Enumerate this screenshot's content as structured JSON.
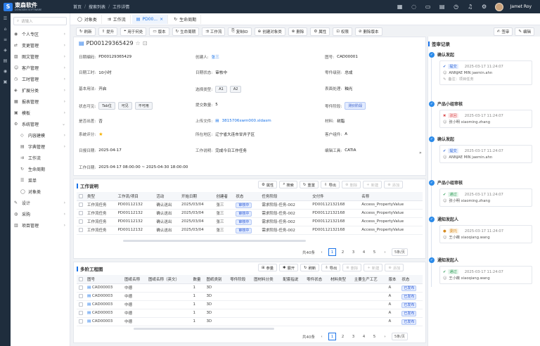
{
  "app": {
    "logo_text": "東森软件",
    "logo_sub": "DONGSEN SOFTWARE",
    "logo_mark": "S"
  },
  "breadcrumb": [
    "首页",
    "搜索列表",
    "工作详情"
  ],
  "user": {
    "name": "Jamet Roy"
  },
  "sidebar": {
    "search_placeholder": "请输入",
    "items": [
      {
        "label": "个人专区",
        "icon": "user-icon",
        "expandable": true
      },
      {
        "label": "变更管理",
        "icon": "swap-icon",
        "expandable": true
      },
      {
        "label": "图文管理",
        "icon": "image-icon",
        "expandable": true
      },
      {
        "label": "客户管理",
        "icon": "client-icon",
        "expandable": true
      },
      {
        "label": "工时管理",
        "icon": "clock-icon",
        "expandable": true
      },
      {
        "label": "扩展分类",
        "icon": "category-icon",
        "expandable": true
      },
      {
        "label": "报表管理",
        "icon": "report-icon",
        "expandable": true
      },
      {
        "label": "模板",
        "icon": "template-icon",
        "expandable": true
      },
      {
        "label": "系统管理",
        "icon": "system-icon",
        "expandable": true,
        "expanded": true
      }
    ],
    "sub_items": [
      {
        "label": "内容建模",
        "icon": "model-icon",
        "expandable": true
      },
      {
        "label": "字典管理",
        "icon": "dict-icon",
        "expandable": true
      },
      {
        "label": "工作流",
        "icon": "flow-icon"
      },
      {
        "label": "生命周期",
        "icon": "cycle-icon"
      },
      {
        "label": "菜单",
        "icon": "menu-icon"
      },
      {
        "label": "对象类",
        "icon": "object-icon"
      }
    ],
    "bottom_items": [
      {
        "label": "设计",
        "icon": "design-icon",
        "expandable": true
      },
      {
        "label": "采购",
        "icon": "cart-icon",
        "expandable": true
      },
      {
        "label": "项目管理",
        "icon": "project-icon",
        "expandable": true
      }
    ]
  },
  "tabs": [
    {
      "label": "对象类",
      "icon": "object-icon"
    },
    {
      "label": "工作流",
      "icon": "flow-icon"
    },
    {
      "label": "PD00...",
      "icon": "doc-icon",
      "active": true,
      "closable": true
    },
    {
      "label": "生命周期",
      "icon": "cycle-icon"
    }
  ],
  "toolbar": {
    "buttons": [
      {
        "label": "刷新",
        "icon": "refresh-icon"
      },
      {
        "label": "提升",
        "icon": "up-icon"
      },
      {
        "label": "用于何处",
        "icon": "where-icon"
      },
      {
        "label": "版本",
        "icon": "version-icon"
      },
      {
        "label": "生命周期",
        "icon": "cycle-icon"
      },
      {
        "label": "工作流",
        "icon": "flow-icon"
      },
      {
        "label": "复制ID",
        "icon": "copy-icon"
      },
      {
        "label": "创建对象类",
        "icon": "plus-icon"
      },
      {
        "label": "删除",
        "icon": "delete-icon"
      },
      {
        "label": "属性",
        "icon": "gear-icon"
      },
      {
        "label": "权限",
        "icon": "lock-icon"
      },
      {
        "label": "删除版本",
        "icon": "delete-version-icon"
      }
    ],
    "right": [
      {
        "label": "签审",
        "icon": "sign-icon"
      },
      {
        "label": "编辑",
        "icon": "edit-icon"
      }
    ]
  },
  "doc": {
    "id": "PD00129365429",
    "fields": [
      {
        "label": "日期编码:",
        "value": "PD00129365429"
      },
      {
        "label": "创建人:",
        "value": "张三",
        "link": true
      },
      {
        "label": "图号:",
        "value": "CAD00001"
      },
      {
        "label": "日期工时:",
        "value": "10小时"
      },
      {
        "label": "日期状态:",
        "value": "审核中"
      },
      {
        "label": "零件级别:",
        "value": "总成"
      },
      {
        "label": "基本用法:",
        "value": "开启"
      },
      {
        "label": "选择类型:",
        "chips": [
          "A1",
          "A2"
        ]
      },
      {
        "label": "表面处理:",
        "value": "釉光"
      },
      {
        "label": "状态可见:",
        "chips": [
          "Tab位",
          "可见",
          "不可用"
        ]
      },
      {
        "label": "提交数量:",
        "value": "5"
      },
      {
        "label": "零件阶段:",
        "chips_blue": [
          "测价阶段"
        ]
      },
      {
        "label": "是否出差:",
        "value": "否"
      },
      {
        "label": "上传文件:",
        "value": "3815706swm000.sldasm",
        "link": true
      },
      {
        "label": "材料:",
        "value": "树脂"
      },
      {
        "label": "系统评分:",
        "value": "★"
      },
      {
        "label": "所在地区:",
        "value": "辽宁省大连市甘井子区"
      },
      {
        "label": "客户组件:",
        "value": "A"
      },
      {
        "label": "日报日期:",
        "value": "2025-04-17"
      },
      {
        "label": "工作说明:",
        "value": "完成今日工作任务"
      },
      {
        "label": "编辑工具:",
        "value": "CATIA"
      },
      {
        "label": "工作日期:",
        "value": "2025-04-17 08:00:00 ~ 2025-04-30 18:00:00"
      }
    ]
  },
  "work_table": {
    "title": "工作说明",
    "buttons": [
      "属性",
      "搜索",
      "重置",
      "导出",
      "删除",
      "新建",
      "添加"
    ],
    "headers": [
      "类型",
      "工作流/项目",
      "活动",
      "开始日期",
      "创建者",
      "状态",
      "任务阶段",
      "交付件",
      "名称"
    ],
    "rows": [
      [
        "工作流任务",
        "PD00112132",
        "确认送出",
        "2025/03/04",
        "张三",
        "审核中",
        "需求阶段-任务-002",
        "PD00112132168",
        "Access_PropertyValue"
      ],
      [
        "工作流任务",
        "PD00112132",
        "确认送出",
        "2025/03/04",
        "张三",
        "审核中",
        "需求阶段-任务-002",
        "PD00112132168",
        "Access_PropertyValue"
      ],
      [
        "工作流任务",
        "PD00112132",
        "确认送出",
        "2025/03/04",
        "张三",
        "审核中",
        "需求阶段-任务-002",
        "PD00112132168",
        "Access_PropertyValue"
      ],
      [
        "工作流任务",
        "PD00112132",
        "确认送出",
        "2025/03/04",
        "张三",
        "审核中",
        "需求阶段-任务-002",
        "PD00112132168",
        "Access_PropertyValue"
      ]
    ],
    "pager": {
      "total": "共40条",
      "pages": [
        "1",
        "2",
        "3",
        "4",
        "5"
      ],
      "size": "5条/页",
      "current": "1"
    }
  },
  "bom_table": {
    "title": "多阶工程图",
    "buttons": [
      "参量",
      "展开",
      "刷新",
      "导出",
      "删除",
      "新建",
      "添加"
    ],
    "headers": [
      "图号",
      "图纸名称",
      "图纸名称（英文）",
      "数量",
      "图纸类别",
      "零件阶段",
      "图材料分类",
      "配套指说",
      "零件状态",
      "材料类型",
      "主要生产工艺",
      "版本",
      "状态"
    ],
    "rows": [
      [
        "CAD00003",
        "中德",
        "",
        "1",
        "3D",
        "",
        "",
        "",
        "",
        "",
        "",
        "A",
        "已发布"
      ],
      [
        "CAD00003",
        "中德",
        "",
        "1",
        "3D",
        "",
        "",
        "",
        "",
        "",
        "",
        "A",
        "已发布"
      ],
      [
        "CAD00003",
        "中德",
        "",
        "1",
        "3D",
        "",
        "",
        "",
        "",
        "",
        "",
        "A",
        "已发布"
      ],
      [
        "CAD00003",
        "中德",
        "",
        "1",
        "3D",
        "",
        "",
        "",
        "",
        "",
        "",
        "A",
        "已发布"
      ],
      [
        "CAD00003",
        "中德",
        "",
        "1",
        "3D",
        "",
        "",
        "",
        "",
        "",
        "",
        "A",
        "已发布"
      ]
    ],
    "pager": {
      "total": "共40条",
      "pages": [
        "1",
        "2",
        "3",
        "4",
        "5"
      ],
      "size": "5条/页",
      "current": "1"
    }
  },
  "approval": {
    "title": "签审记录",
    "steps": [
      {
        "name": "确认发起",
        "status": "提交",
        "status_kind": "sub",
        "time": "2025-03-17  11:24:07",
        "user": "ANNJAE MIN jaemin.ahn",
        "note": "备注：项目任务"
      },
      {
        "name": "产品小组审核",
        "status": "驳回",
        "status_kind": "rej",
        "time": "2025-03-17  11:24:07",
        "user": "张小明 xiaoming.zhang",
        "note": ""
      },
      {
        "name": "确认发起",
        "status": "提交",
        "status_kind": "sub",
        "time": "2025-03-17  11:24:07",
        "user": "ANNJAE MIN jaemin.ahn",
        "note": ""
      },
      {
        "name": "产品小组审核",
        "status": "通过",
        "status_kind": "ok",
        "time": "2025-03-17  11:24:07",
        "user": "张小明 xiaoming.zhang",
        "note": ""
      },
      {
        "name": "通知发起人",
        "status": "委托",
        "status_kind": "pend",
        "time": "2025-03-17  11:24:07",
        "user": "王小薇 xiaoqiang.wang",
        "note": ""
      },
      {
        "name": "通知发起人",
        "status": "通过",
        "status_kind": "ok",
        "time": "2025-03-17  11:24:07",
        "user": "王小薇 xiaoqiang.wang",
        "note": ""
      }
    ]
  }
}
